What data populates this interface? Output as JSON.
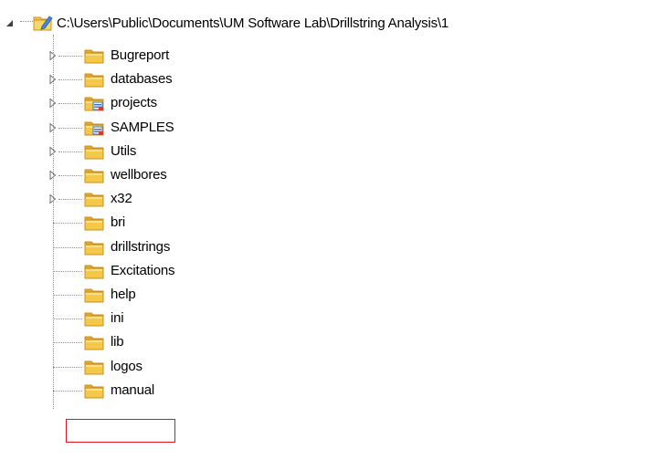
{
  "tree": {
    "root": {
      "label": "C:\\Users\\Public\\Documents\\UM Software Lab\\Drillstring Analysis\\1",
      "icon": "folder-edit-icon",
      "expanded": true
    },
    "children": [
      {
        "label": "Bugreport",
        "icon": "folder-icon",
        "expandable": true
      },
      {
        "label": "databases",
        "icon": "folder-icon",
        "expandable": true
      },
      {
        "label": "projects",
        "icon": "folder-special-icon",
        "expandable": true
      },
      {
        "label": "SAMPLES",
        "icon": "folder-special-icon",
        "expandable": true
      },
      {
        "label": "Utils",
        "icon": "folder-icon",
        "expandable": true
      },
      {
        "label": "wellbores",
        "icon": "folder-icon",
        "expandable": true
      },
      {
        "label": "x32",
        "icon": "folder-icon",
        "expandable": true
      },
      {
        "label": "bri",
        "icon": "folder-icon",
        "expandable": false
      },
      {
        "label": "drillstrings",
        "icon": "folder-icon",
        "expandable": false
      },
      {
        "label": "Excitations",
        "icon": "folder-icon",
        "expandable": false
      },
      {
        "label": "help",
        "icon": "folder-icon",
        "expandable": false
      },
      {
        "label": "ini",
        "icon": "folder-icon",
        "expandable": false
      },
      {
        "label": "lib",
        "icon": "folder-icon",
        "expandable": false
      },
      {
        "label": "logos",
        "icon": "folder-icon",
        "expandable": false,
        "highlighted": true
      },
      {
        "label": "manual",
        "icon": "folder-icon",
        "expandable": false
      }
    ]
  },
  "colors": {
    "folder_body": "#f5c84a",
    "folder_tab": "#e8a82a",
    "folder_edge": "#c8901e",
    "special_badge": "#3a6fc8",
    "special_badge_red": "#d83a2a",
    "highlight_border": "#e0141e",
    "connector": "#8f8f8f"
  }
}
